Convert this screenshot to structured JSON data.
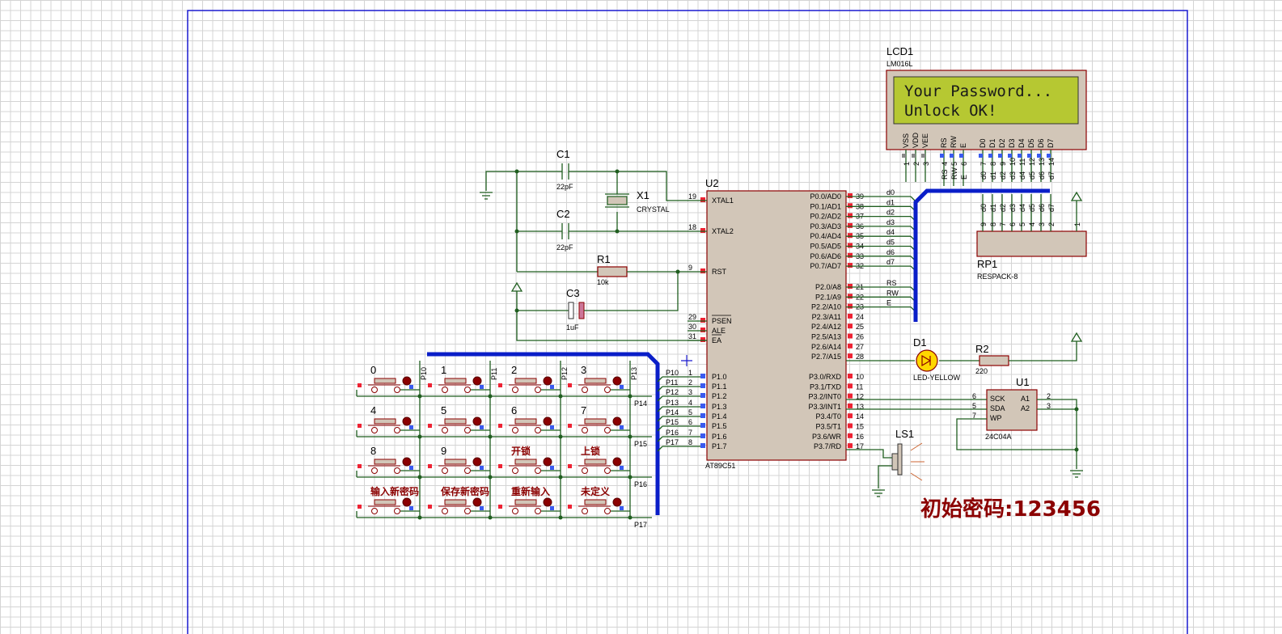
{
  "lcd": {
    "ref": "LCD1",
    "model": "LM016L",
    "line1": "Your Password...",
    "line2": "Unlock OK!",
    "pins": [
      "VSS",
      "VDD",
      "VEE",
      "RS",
      "RW",
      "E",
      "D0",
      "D1",
      "D2",
      "D3",
      "D4",
      "D5",
      "D6",
      "D7"
    ],
    "pin_numbers": [
      "1",
      "2",
      "3",
      "4",
      "5",
      "6",
      "7",
      "8",
      "9",
      "10",
      "11",
      "12",
      "13",
      "14"
    ],
    "net_labels": [
      "RS",
      "RW",
      "E",
      "d0",
      "d1",
      "d2",
      "d3",
      "d4",
      "d5",
      "d6",
      "d7"
    ]
  },
  "mcu": {
    "ref": "U2",
    "model": "AT89C51",
    "left_pins": [
      {
        "num": "19",
        "name": "XTAL1"
      },
      {
        "num": "18",
        "name": "XTAL2"
      },
      {
        "num": "9",
        "name": "RST"
      },
      {
        "num": "29",
        "name": "PSEN"
      },
      {
        "num": "30",
        "name": "ALE"
      },
      {
        "num": "31",
        "name": "EA"
      },
      {
        "num": "1",
        "name": "P1.0"
      },
      {
        "num": "2",
        "name": "P1.1"
      },
      {
        "num": "3",
        "name": "P1.2"
      },
      {
        "num": "4",
        "name": "P1.3"
      },
      {
        "num": "5",
        "name": "P1.4"
      },
      {
        "num": "6",
        "name": "P1.5"
      },
      {
        "num": "7",
        "name": "P1.6"
      },
      {
        "num": "8",
        "name": "P1.7"
      }
    ],
    "right_pins": [
      {
        "num": "39",
        "name": "P0.0/AD0",
        "net": "d0"
      },
      {
        "num": "38",
        "name": "P0.1/AD1",
        "net": "d1"
      },
      {
        "num": "37",
        "name": "P0.2/AD2",
        "net": "d2"
      },
      {
        "num": "36",
        "name": "P0.3/AD3",
        "net": "d3"
      },
      {
        "num": "35",
        "name": "P0.4/AD4",
        "net": "d4"
      },
      {
        "num": "34",
        "name": "P0.5/AD5",
        "net": "d5"
      },
      {
        "num": "33",
        "name": "P0.6/AD6",
        "net": "d6"
      },
      {
        "num": "32",
        "name": "P0.7/AD7",
        "net": "d7"
      },
      {
        "num": "21",
        "name": "P2.0/A8",
        "net": "RS"
      },
      {
        "num": "22",
        "name": "P2.1/A9",
        "net": "RW"
      },
      {
        "num": "23",
        "name": "P2.2/A10",
        "net": "E"
      },
      {
        "num": "24",
        "name": "P2.3/A11",
        "net": ""
      },
      {
        "num": "25",
        "name": "P2.4/A12",
        "net": ""
      },
      {
        "num": "26",
        "name": "P2.5/A13",
        "net": ""
      },
      {
        "num": "27",
        "name": "P2.6/A14",
        "net": ""
      },
      {
        "num": "28",
        "name": "P2.7/A15",
        "net": ""
      },
      {
        "num": "10",
        "name": "P3.0/RXD",
        "net": ""
      },
      {
        "num": "11",
        "name": "P3.1/TXD",
        "net": ""
      },
      {
        "num": "12",
        "name": "P3.2/INT0",
        "net": ""
      },
      {
        "num": "13",
        "name": "P3.3/INT1",
        "net": ""
      },
      {
        "num": "14",
        "name": "P3.4/T0",
        "net": ""
      },
      {
        "num": "15",
        "name": "P3.5/T1",
        "net": ""
      },
      {
        "num": "16",
        "name": "P3.6/WR",
        "net": ""
      },
      {
        "num": "17",
        "name": "P3.7/RD",
        "net": ""
      }
    ],
    "port1_nets": [
      "P10",
      "P11",
      "P12",
      "P13",
      "P14",
      "P15",
      "P16",
      "P17"
    ]
  },
  "caps": {
    "c1": {
      "ref": "C1",
      "value": "22pF"
    },
    "c2": {
      "ref": "C2",
      "value": "22pF"
    },
    "c3": {
      "ref": "C3",
      "value": "1uF"
    }
  },
  "crystal": {
    "ref": "X1",
    "value": "CRYSTAL"
  },
  "r1": {
    "ref": "R1",
    "value": "10k"
  },
  "r2": {
    "ref": "R2",
    "value": "220"
  },
  "led": {
    "ref": "D1",
    "value": "LED-YELLOW"
  },
  "rpack": {
    "ref": "RP1",
    "value": "RESPACK-8",
    "pins": [
      "d0",
      "d1",
      "d2",
      "d3",
      "d4",
      "d5",
      "d6",
      "d7"
    ],
    "pin_numbers": [
      "9",
      "8",
      "7",
      "6",
      "5",
      "4",
      "3",
      "2"
    ],
    "common": "1"
  },
  "eeprom": {
    "ref": "U1",
    "model": "24C04A",
    "pins_left": [
      {
        "num": "6",
        "name": "SCK"
      },
      {
        "num": "5",
        "name": "SDA"
      },
      {
        "num": "7",
        "name": "WP"
      }
    ],
    "pins_right": [
      {
        "num": "2",
        "name": "A1"
      },
      {
        "num": "3",
        "name": "A2"
      }
    ]
  },
  "speaker": {
    "ref": "LS1"
  },
  "keypad": {
    "keys": [
      "0",
      "1",
      "2",
      "3",
      "4",
      "5",
      "6",
      "7",
      "8",
      "9",
      "开锁",
      "上锁",
      "输入新密码",
      "保存新密码",
      "重新输入",
      "未定义"
    ],
    "col_nets": [
      "P10",
      "P11",
      "P12",
      "P13"
    ],
    "row_nets": [
      "P14",
      "P15",
      "P16",
      "P17"
    ]
  },
  "note": "初始密码:123456",
  "colors": {
    "wire": "#1f5e1f",
    "bus": "#0a1ec8",
    "part": "#8b0000",
    "chip_fill": "#d2c6b8",
    "lcd_screen": "#b6c832",
    "border": "#1a1ad0"
  }
}
